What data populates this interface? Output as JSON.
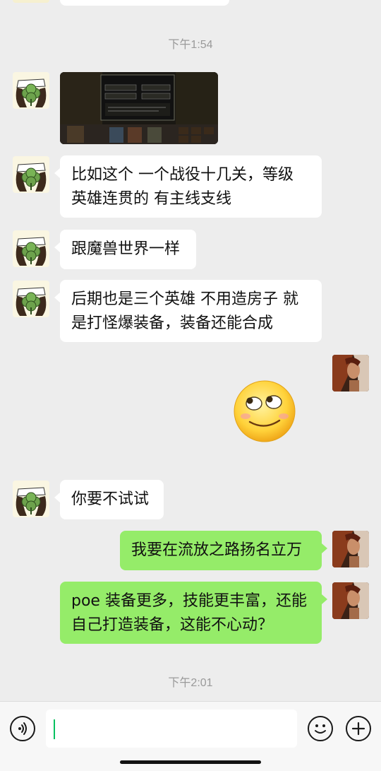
{
  "timestamps": [
    "下午1:54",
    "下午2:01"
  ],
  "messages": [
    {
      "from": "other",
      "type": "image",
      "alt": "game screenshot"
    },
    {
      "from": "other",
      "type": "text",
      "text": "比如这个 一个战役十几关，等级\n英雄连贯的 有主线支线"
    },
    {
      "from": "other",
      "type": "text",
      "text": "跟魔兽世界一样"
    },
    {
      "from": "other",
      "type": "text",
      "text": "后期也是三个英雄 不用造房子 就\n是打怪爆装备，装备还能合成"
    },
    {
      "from": "self",
      "type": "emoji",
      "emoji": "rolling-eyes-smile"
    },
    {
      "from": "other",
      "type": "text",
      "text": "你要不试试"
    },
    {
      "from": "self",
      "type": "text",
      "text": "我要在流放之路扬名立万"
    },
    {
      "from": "self",
      "type": "text",
      "text": "poe 装备更多，技能更丰富，还能\n自己打造装备，这能不心动？"
    }
  ],
  "input_bar": {
    "voice_icon": "voice-icon",
    "emoji_icon": "emoji-icon",
    "plus_icon": "plus-icon",
    "text_value": ""
  },
  "colors": {
    "background": "#ededed",
    "self_bubble": "#95ec69",
    "other_bubble": "#ffffff",
    "cursor": "#07c160"
  }
}
